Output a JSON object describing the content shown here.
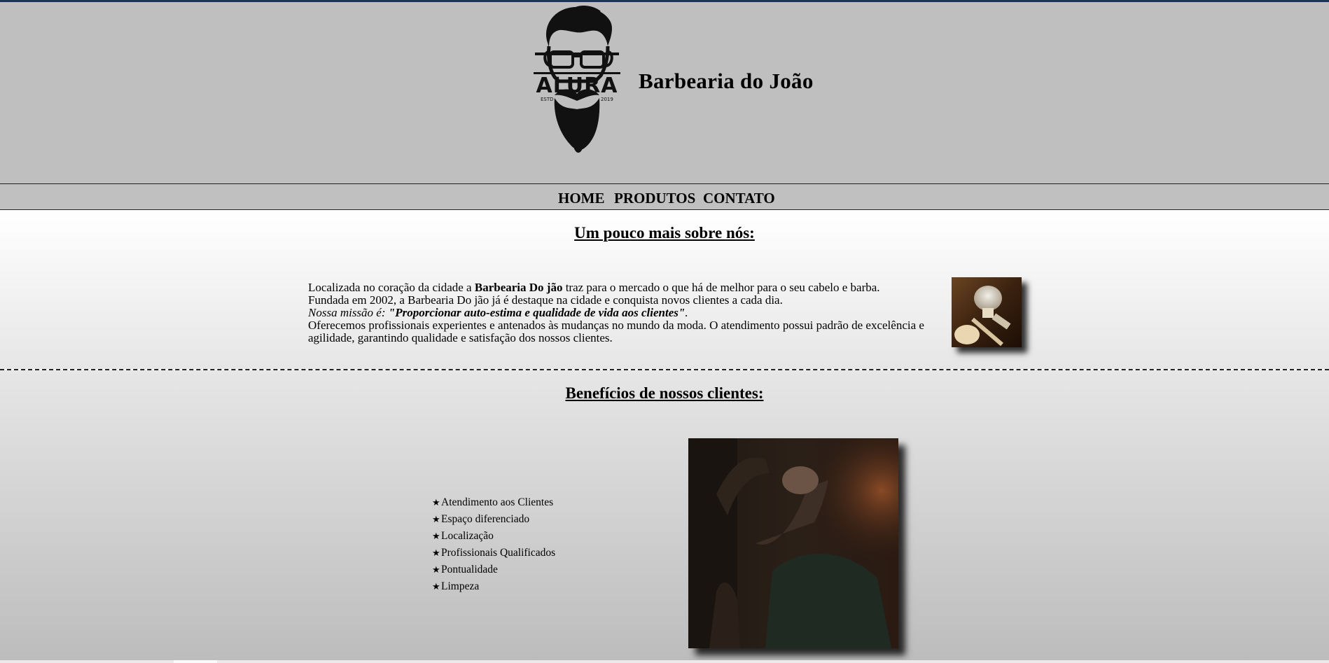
{
  "header": {
    "logo": {
      "brand": "ALURA",
      "est": "ESTD",
      "year": "2019"
    },
    "title": "Barbearia do João"
  },
  "nav": {
    "items": [
      "HOME",
      "PRODUTOS",
      "CONTATO"
    ]
  },
  "about": {
    "heading": "Um pouco mais sobre nós:",
    "line1_pre": "Localizada no coração da cidade a ",
    "line1_bold": "Barbearia Do jão",
    "line1_post": " traz para o mercado o que há de melhor para o seu cabelo e barba.",
    "line2": "Fundada em 2002, a Barbearia Do jão já é destaque na cidade e conquista novos clientes a cada dia.",
    "mission_label": "Nossa missão é: ",
    "mission_text": "\"Proporcionar auto-estima e qualidade de vida aos clientes\"",
    "mission_end": ".",
    "line4": "Oferecemos profissionais experientes e antenados às mudanças no mundo da moda. O atendimento possui padrão de excelência e agilidade, garantindo qualidade e satisfação dos nossos clientes.",
    "image": "shaving-brush-and-razor-photo"
  },
  "benefits": {
    "heading": "Benefícios de nossos clientes:",
    "bullet": "★",
    "items": [
      "Atendimento aos Clientes",
      "Espaço diferenciado",
      "Localização",
      "Profissionais Qualificados",
      "Pontualidade",
      "Limpeza"
    ],
    "image": "barber-shaving-client-photo"
  }
}
